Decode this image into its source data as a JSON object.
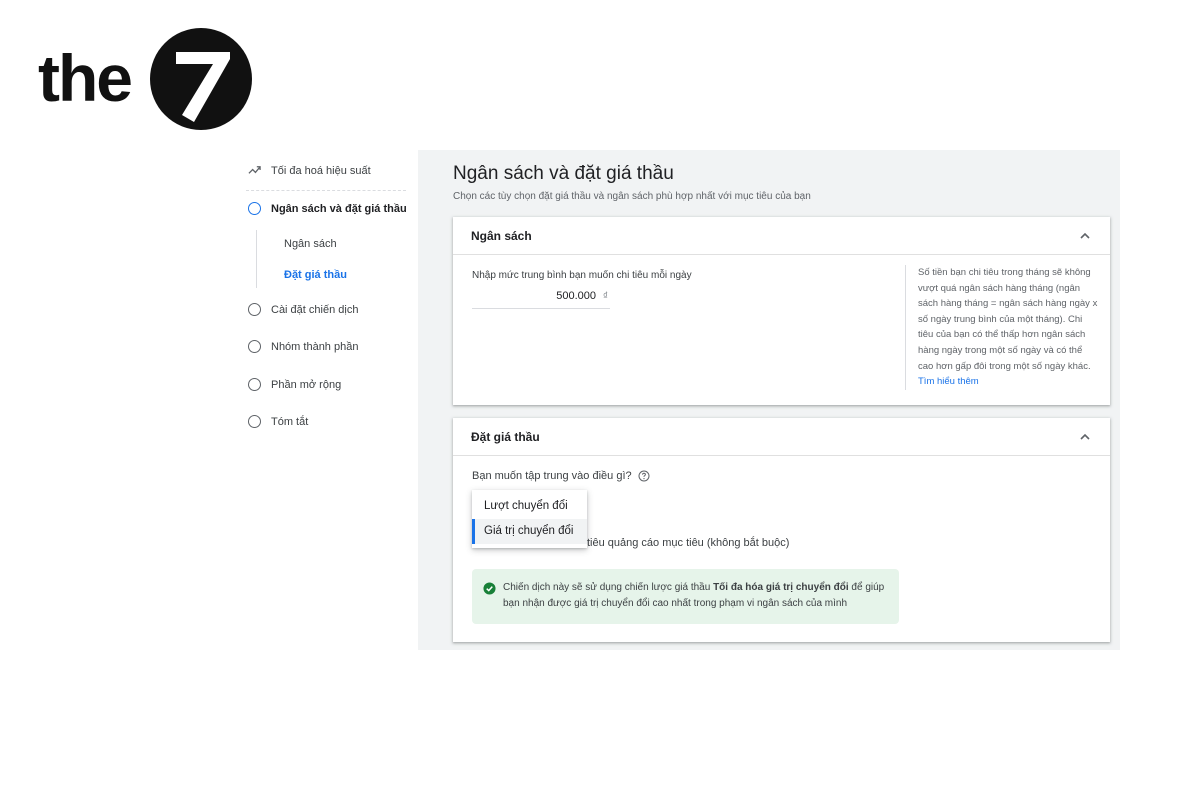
{
  "logo": {
    "text": "the",
    "numeral": "7"
  },
  "sidebar": {
    "items": [
      {
        "label": "Tối đa hoá hiệu suất",
        "icon": "trending-icon"
      },
      {
        "label": "Ngân sách và đặt giá thầu",
        "state": "active"
      },
      {
        "label": "Cài đặt chiến dịch"
      },
      {
        "label": "Nhóm thành phần"
      },
      {
        "label": "Phần mở rộng"
      },
      {
        "label": "Tóm tắt"
      }
    ],
    "subitems": [
      {
        "label": "Ngân sách"
      },
      {
        "label": "Đặt giá thầu",
        "state": "current"
      }
    ]
  },
  "main": {
    "title": "Ngân sách và đặt giá thầu",
    "subtitle": "Chọn các tùy chọn đặt giá thầu và ngân sách phù hợp nhất với mục tiêu của bạn"
  },
  "budget_card": {
    "title": "Ngân sách",
    "field_label": "Nhập mức trung bình bạn muốn chi tiêu mỗi ngày",
    "value": "500.000",
    "currency": "₫",
    "note": "Số tiền bạn chi tiêu trong tháng sẽ không vượt quá ngân sách hàng tháng (ngân sách hàng tháng = ngân sách hàng ngày x số ngày trung bình của một tháng). Chi tiêu của bạn có thể thấp hơn ngân sách hàng ngày trong một số ngày và có thể cao hơn gấp đôi trong một số ngày khác.",
    "note_link": "Tìm hiểu thêm"
  },
  "bidding_card": {
    "title": "Đặt giá thầu",
    "question": "Bạn muốn tập trung vào điều gì?",
    "dropdown_options": [
      "Lượt chuyển đổi",
      "Giá trị chuyển đổi"
    ],
    "selected_option": "Giá trị chuyển đổi",
    "optional_text": "tiêu quảng cáo mục tiêu (không bắt buộc)",
    "info_prefix": "Chiến dịch này sẽ sử dụng chiến lược giá thầu ",
    "info_bold": "Tối đa hóa giá trị chuyển đổi",
    "info_suffix": " để giúp bạn nhận được giá trị chuyển đổi cao nhất trong phạm vi ngân sách của mình"
  },
  "colors": {
    "accent": "#1a73e8",
    "info_background": "#e6f4ea",
    "success": "#188038",
    "frame_background": "#f1f3f4"
  }
}
